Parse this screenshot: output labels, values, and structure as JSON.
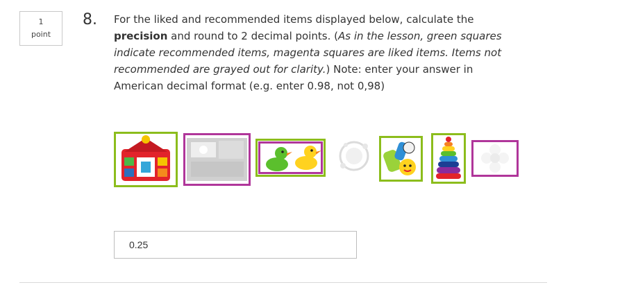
{
  "question": {
    "points_value": "1",
    "points_label": "point",
    "number": "8.",
    "text_1": "For the liked and recommended items displayed below, calculate the ",
    "text_bold": "precision",
    "text_2": " and round to 2 decimal points. (",
    "text_italic": "As in the lesson, green squares indicate recommended items, magenta squares are liked items. Items not recommended are grayed out for clarity.",
    "text_3": ") Note: enter your answer in American decimal format (e.g. enter 0.98, not 0,98)"
  },
  "items": [
    {
      "name": "toy-farmhouse",
      "recommended": true,
      "liked": false
    },
    {
      "name": "toy-book",
      "recommended": false,
      "liked": true
    },
    {
      "name": "rubber-ducks",
      "recommended": true,
      "liked": true
    },
    {
      "name": "toy-rattle",
      "recommended": false,
      "liked": false
    },
    {
      "name": "baby-teether",
      "recommended": true,
      "liked": false
    },
    {
      "name": "stacking-rings",
      "recommended": true,
      "liked": false
    },
    {
      "name": "flower-toy",
      "recommended": false,
      "liked": true
    }
  ],
  "colors": {
    "recommended_border": "#8cbd1c",
    "liked_border": "#b0369a"
  },
  "answer": {
    "value": "0.25"
  }
}
